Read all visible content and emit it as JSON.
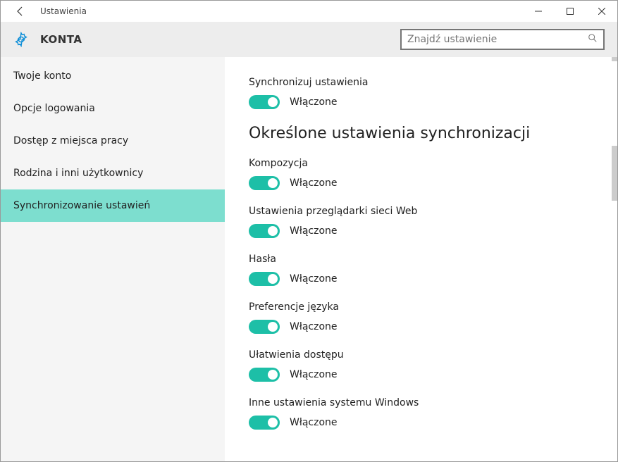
{
  "titlebar": {
    "title": "Ustawienia"
  },
  "header": {
    "title": "KONTA",
    "search_placeholder": "Znajdź ustawienie"
  },
  "sidebar": {
    "items": [
      {
        "label": "Twoje konto"
      },
      {
        "label": "Opcje logowania"
      },
      {
        "label": "Dostęp z miejsca pracy"
      },
      {
        "label": "Rodzina i inni użytkownicy"
      },
      {
        "label": "Synchronizowanie ustawień"
      }
    ]
  },
  "main": {
    "sync_label": "Synchronizuj ustawienia",
    "sync_state": "Włączone",
    "section_title": "Określone ustawienia synchronizacji",
    "toggles": [
      {
        "label": "Kompozycja",
        "state": "Włączone"
      },
      {
        "label": "Ustawienia przeglądarki sieci Web",
        "state": "Włączone"
      },
      {
        "label": "Hasła",
        "state": "Włączone"
      },
      {
        "label": "Preferencje języka",
        "state": "Włączone"
      },
      {
        "label": "Ułatwienia dostępu",
        "state": "Włączone"
      },
      {
        "label": "Inne ustawienia systemu Windows",
        "state": "Włączone"
      }
    ]
  }
}
